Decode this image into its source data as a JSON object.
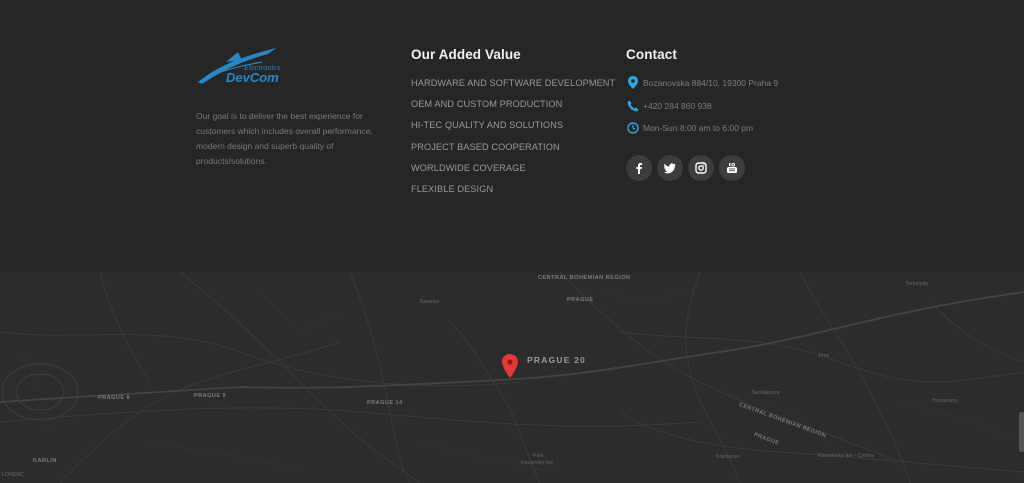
{
  "brand": {
    "logo_word": "DevCom",
    "logo_script": "Electronics",
    "about": "Our goal is to deliver the best experience for customers which includes overall performance, modern design and superb quality of products/solutions."
  },
  "added_value": {
    "title": "Our Added Value",
    "items": [
      "HARDWARE AND SOFTWARE DEVELOPMENT",
      "OEM AND CUSTOM PRODUCTION",
      "HI-TEC QUALITY AND SOLUTIONS",
      "PROJECT BASED COOPERATION",
      "WORLDWIDE COVERAGE",
      "FLEXIBLE DESIGN"
    ]
  },
  "contact": {
    "title": "Contact",
    "address": "Bozanovska 884/10, 19300 Praha 9",
    "phone": "+420 284 860 938",
    "hours": "Mon-Sun 8:00 am to 6:00 pm",
    "icons": [
      "map-pin-icon",
      "phone-icon",
      "clock-icon"
    ],
    "accent": "#29a9e0"
  },
  "socials": [
    "facebook-icon",
    "twitter-icon",
    "instagram-icon",
    "youtube-icon"
  ],
  "map": {
    "labels": {
      "prague20": "PRAGUE 20",
      "central_top": "CENTRAL BOHEMIAN REGION",
      "central_right": "CENTRAL BOHEMIAN REGION",
      "prague": "PRAGUE",
      "prague_r": "PRAGUE",
      "prague8": "PRAGUE 8",
      "prague9": "PRAGUE 9",
      "prague14": "PRAGUE 14",
      "karlin": "KARLIN",
      "lorenc": "LORENC",
      "satalice": "Satalice",
      "nehvizdy": "Nehvizdy",
      "jirny": "Jirny",
      "sestajovice": "Sestajovice",
      "horousany": "Horousany",
      "klanovice": "Klanovice",
      "klanovicky": "Klanovicky les - Cyrilov",
      "park": "Park",
      "kavansky": "Kavansky Ins"
    },
    "marker_color": "#e53935"
  }
}
